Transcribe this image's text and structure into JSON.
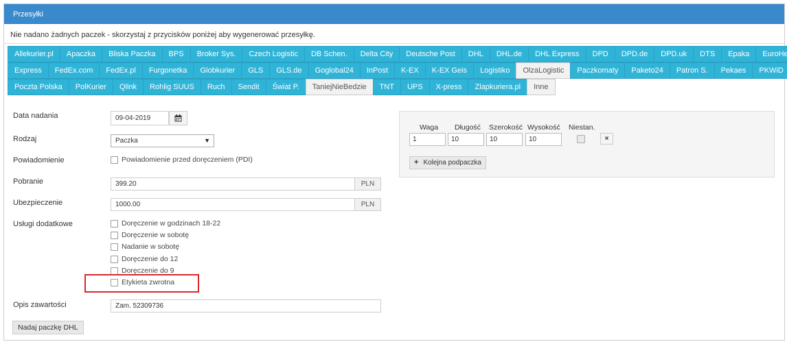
{
  "panel": {
    "title": "Przesyłki",
    "notice": "Nie nadano żadnych paczek - skorzystaj z przycisków poniżej aby wygenerować przesyłkę."
  },
  "tabs": {
    "rows": [
      [
        "Allekurier.pl",
        "Apaczka",
        "Bliska Paczka",
        "BPS",
        "Broker Sys.",
        "Czech Logistic",
        "DB Schen.",
        "Delta City",
        "Deutsche Post",
        "DHL",
        "DHL.de",
        "DHL Express",
        "DPD",
        "DPD.de",
        "DPD.uk",
        "DTS",
        "Epaka",
        "EuroHermes"
      ],
      [
        "Express",
        "FedEx.com",
        "FedEx.pl",
        "Furgonetka",
        "Globkurier",
        "GLS",
        "GLS.de",
        "Goglobal24",
        "InPost",
        "K-EX",
        "K-EX Geis",
        "Logistiko",
        "OlzaLogistic",
        "Paczkomaty",
        "Paketo24",
        "Patron S.",
        "Pekaes",
        "PKWiD"
      ],
      [
        "Poczta Polska",
        "PolKurier",
        "Qlink",
        "Rohlig SUUS",
        "Ruch",
        "Sendit",
        "Świat P.",
        "TaniejNieBedzie",
        "TNT",
        "UPS",
        "X-press",
        "Zlapkuriera.pl",
        "Inne"
      ]
    ],
    "active": [
      "OlzaLogistic",
      "TaniejNieBedzie",
      "Inne"
    ],
    "active_color": "#f2f2f2",
    "tab_color": "#2fb4d8"
  },
  "form": {
    "date_label": "Data nadania",
    "date_value": "09-04-2019",
    "type_label": "Rodzaj",
    "type_value": "Paczka",
    "notify_label": "Powiadomienie",
    "notify_option": "Powiadomienie przed doręczeniem (PDI)",
    "cod_label": "Pobranie",
    "cod_value": "399.20",
    "cod_currency": "PLN",
    "insurance_label": "Ubezpieczenie",
    "insurance_value": "1000.00",
    "insurance_currency": "PLN",
    "extras_label": "Usługi dodatkowe",
    "extras": [
      "Doręczenie w godzinach 18-22",
      "Doręczenie w sobotę",
      "Nadanie w sobotę",
      "Doręczenie do 12",
      "Doręczenie do 9",
      "Etykieta zwrotna"
    ],
    "contents_label": "Opis zawartości",
    "contents_value": "Zam. 52309736",
    "submit_label": "Nadaj paczkę DHL"
  },
  "package": {
    "headers": [
      "Waga",
      "Długość",
      "Szerokość",
      "Wysokość",
      "Niestan."
    ],
    "weight": "1",
    "length": "10",
    "width": "10",
    "height": "10",
    "remove_label": "×",
    "add_label": "Kolejna podpaczka"
  },
  "highlight_color": "#d9262b"
}
